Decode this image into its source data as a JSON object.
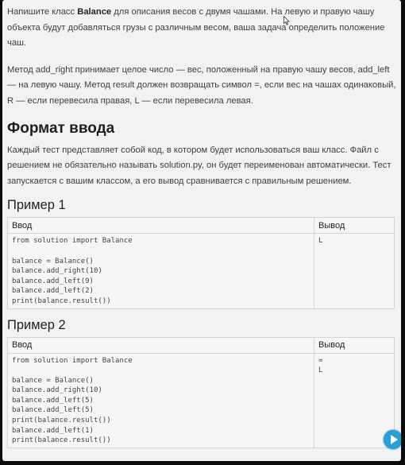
{
  "task": {
    "p1_pre": "Напишите класс ",
    "p1_bold": "Balance",
    "p1_post": " для описания весов с двумя чашами. На левую и правую чашу объекта будут добавляться грузы с различным весом, ваша задача определить положение чаш.",
    "p2": "Метод add_right принимает целое число — вес, положенный на правую чашу весов, add_left — на левую чашу. Метод result должен возвращать символ =, если вес на чашах одинаковый, R — если перевесила правая, L — если перевесила левая."
  },
  "input_format": {
    "heading": "Формат ввода",
    "text": "Каждый тест представляет собой код, в котором будет использоваться ваш класс. Файл с решением не обязательно называть solution.py, он будет переименован автоматически. Тест запускается с вашим классом, а его вывод сравнивается с правильным решением."
  },
  "examples": [
    {
      "heading": "Пример 1",
      "input_header": "Ввод",
      "output_header": "Вывод",
      "input_lines": [
        "from solution import Balance",
        "",
        "balance = Balance()",
        "balance.add_right(10)",
        "balance.add_left(9)",
        "balance.add_left(2)",
        "print(balance.result())"
      ],
      "output_lines": [
        "L"
      ]
    },
    {
      "heading": "Пример 2",
      "input_header": "Ввод",
      "output_header": "Вывод",
      "input_lines": [
        "from solution import Balance",
        "",
        "balance = Balance()",
        "balance.add_right(10)",
        "balance.add_left(5)",
        "balance.add_left(5)",
        "print(balance.result())",
        "balance.add_left(1)",
        "print(balance.result())"
      ],
      "output_lines": [
        "=",
        "L"
      ]
    }
  ],
  "icons": {
    "cursor": "mouse-cursor-icon",
    "play": "play-icon"
  },
  "colors": {
    "page_bg": "#f2f2f2",
    "frame_bg": "#0b0b0b",
    "play_button": "#2a9fd6"
  }
}
